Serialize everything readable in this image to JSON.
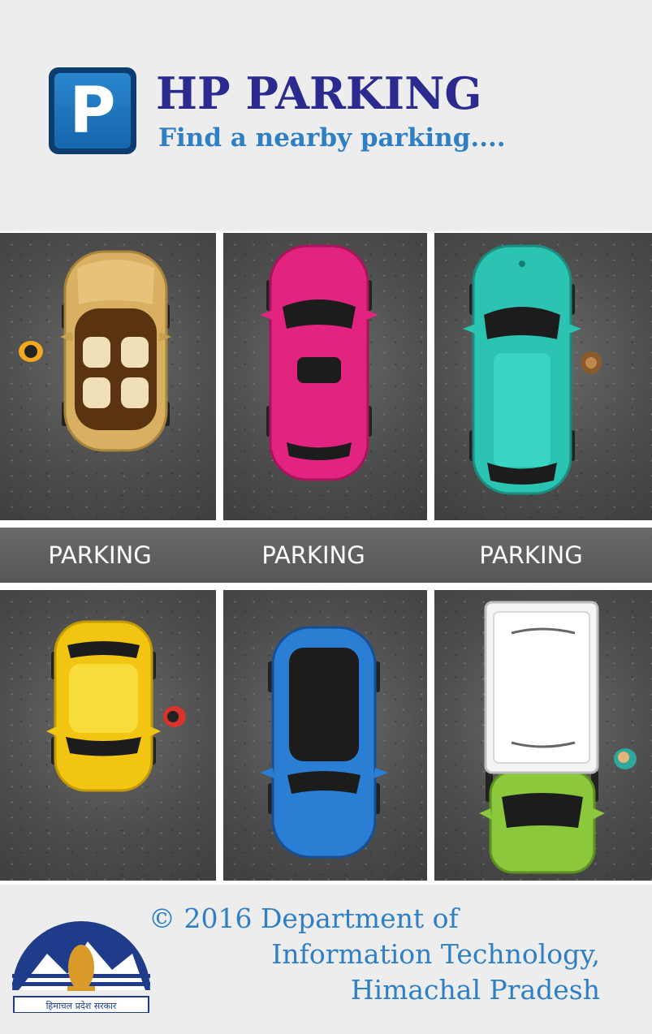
{
  "header": {
    "logo_letter": "P",
    "title": "HP PARKING",
    "subtitle": "Find a nearby parking...."
  },
  "lane": {
    "labels": [
      "PARKING",
      "PARKING",
      "PARKING"
    ]
  },
  "cars": [
    {
      "name": "convertible",
      "color": "#d9b061"
    },
    {
      "name": "pink-car",
      "color": "#e2237f"
    },
    {
      "name": "teal-car",
      "color": "#2bc4b2"
    },
    {
      "name": "yellow-car",
      "color": "#f2c513"
    },
    {
      "name": "blue-car",
      "color": "#2a7ed3"
    },
    {
      "name": "truck",
      "color": "#8bc83b"
    }
  ],
  "footer": {
    "line1": "© 2016 Department of",
    "line2": "Information Technology,",
    "line3": "Himachal Pradesh",
    "emblem_text": "हिमाचल प्रदेश सरकार"
  },
  "colors": {
    "title": "#2b2b8f",
    "subtitle": "#2f7fc4",
    "logo": "#1a6db5"
  }
}
